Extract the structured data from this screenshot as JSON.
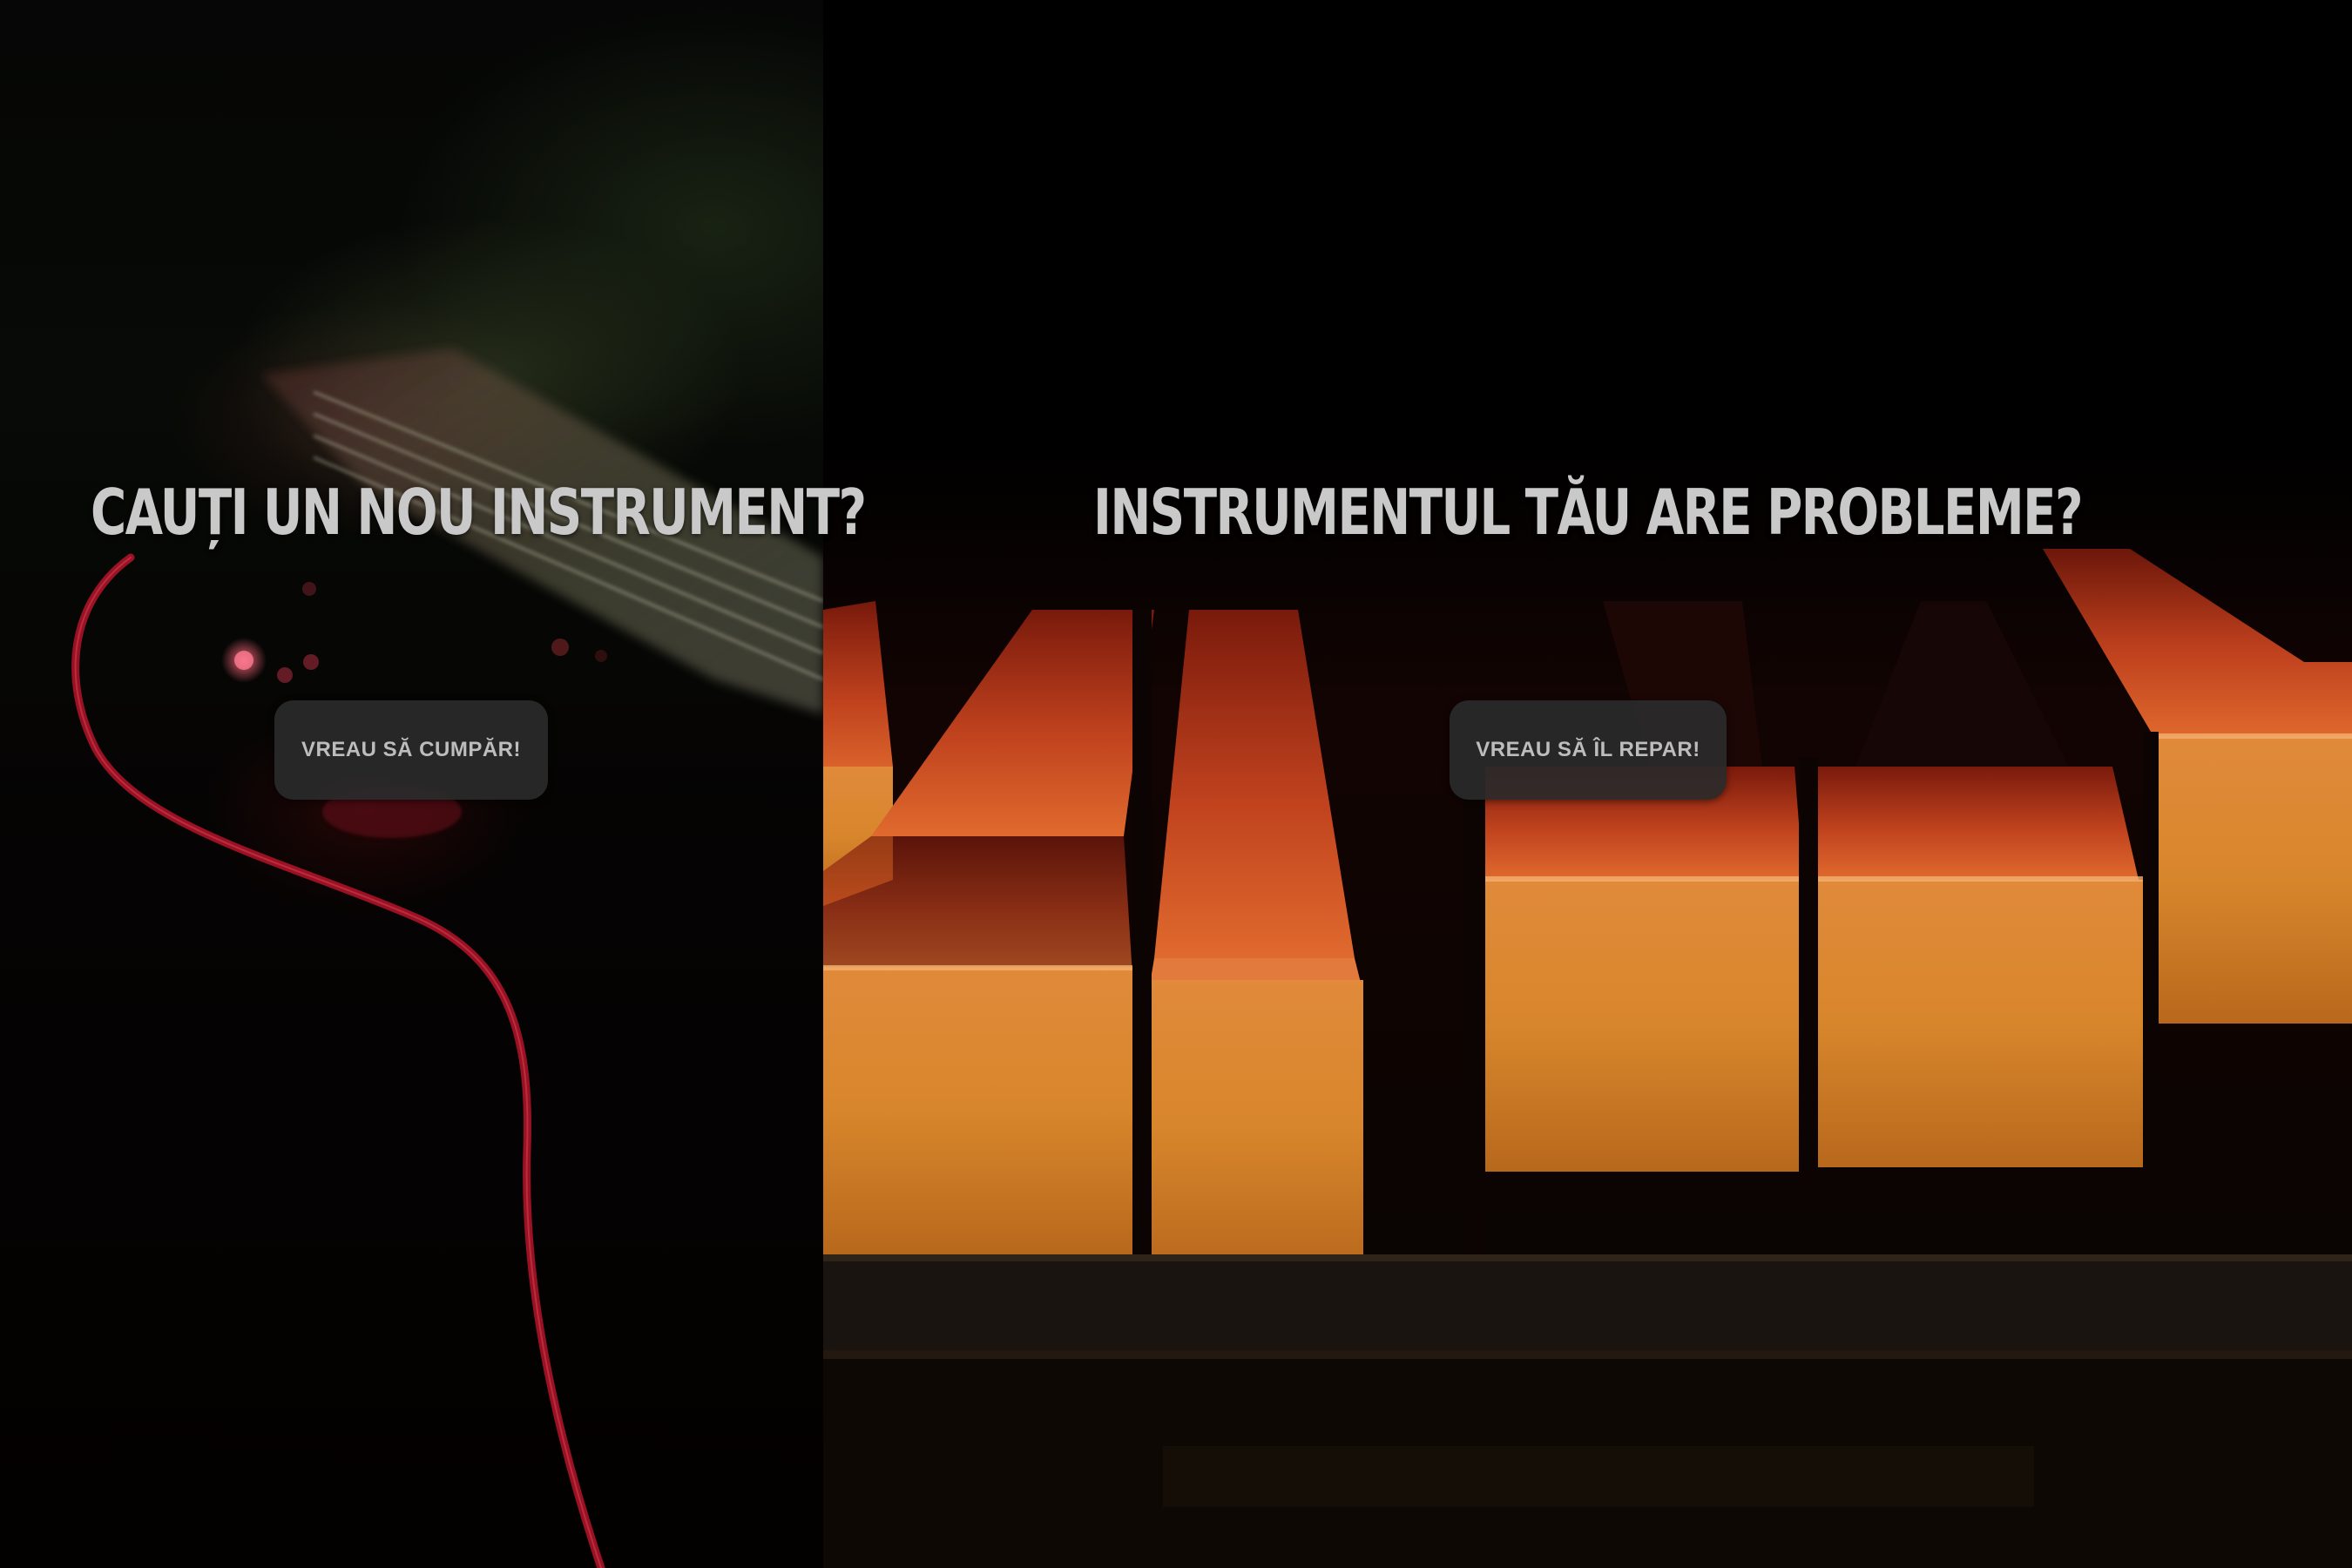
{
  "sections": {
    "buy": {
      "heading": "CAUȚI UN NOU INSTRUMENT?",
      "button_label": "VREAU SĂ CUMPĂR!",
      "background_image": "guitar-photo"
    },
    "repair": {
      "heading": "INSTRUMENTUL TĂU ARE PROBLEME?",
      "button_label": "VREAU SĂ ÎL REPAR!",
      "background_image": "piano-keys-photo"
    }
  },
  "colors": {
    "page_background": "#000000",
    "heading_text": "#c9c9c9",
    "button_background": "#2a2a2a",
    "button_text": "#bdbdbd",
    "cable_red": "#b3152a",
    "piano_key_orange": "#d8862c"
  }
}
